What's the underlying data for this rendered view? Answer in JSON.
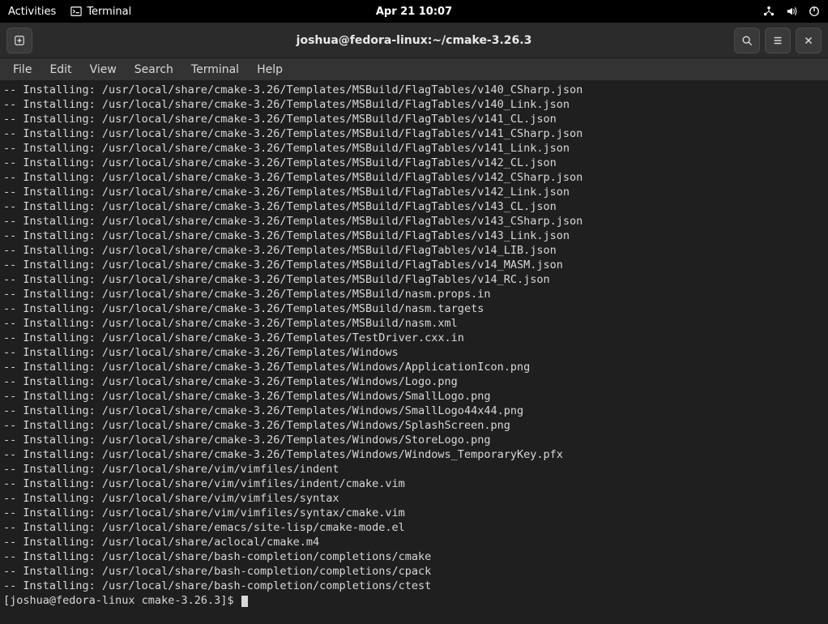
{
  "topbar": {
    "activities": "Activities",
    "app_name": "Terminal",
    "datetime": "Apr 21  10:07"
  },
  "titlebar": {
    "title": "joshua@fedora-linux:~/cmake-3.26.3"
  },
  "menubar": {
    "file": "File",
    "edit": "Edit",
    "view": "View",
    "search": "Search",
    "terminal": "Terminal",
    "help": "Help"
  },
  "terminal": {
    "lines": [
      "-- Installing: /usr/local/share/cmake-3.26/Templates/MSBuild/FlagTables/v140_CSharp.json",
      "-- Installing: /usr/local/share/cmake-3.26/Templates/MSBuild/FlagTables/v140_Link.json",
      "-- Installing: /usr/local/share/cmake-3.26/Templates/MSBuild/FlagTables/v141_CL.json",
      "-- Installing: /usr/local/share/cmake-3.26/Templates/MSBuild/FlagTables/v141_CSharp.json",
      "-- Installing: /usr/local/share/cmake-3.26/Templates/MSBuild/FlagTables/v141_Link.json",
      "-- Installing: /usr/local/share/cmake-3.26/Templates/MSBuild/FlagTables/v142_CL.json",
      "-- Installing: /usr/local/share/cmake-3.26/Templates/MSBuild/FlagTables/v142_CSharp.json",
      "-- Installing: /usr/local/share/cmake-3.26/Templates/MSBuild/FlagTables/v142_Link.json",
      "-- Installing: /usr/local/share/cmake-3.26/Templates/MSBuild/FlagTables/v143_CL.json",
      "-- Installing: /usr/local/share/cmake-3.26/Templates/MSBuild/FlagTables/v143_CSharp.json",
      "-- Installing: /usr/local/share/cmake-3.26/Templates/MSBuild/FlagTables/v143_Link.json",
      "-- Installing: /usr/local/share/cmake-3.26/Templates/MSBuild/FlagTables/v14_LIB.json",
      "-- Installing: /usr/local/share/cmake-3.26/Templates/MSBuild/FlagTables/v14_MASM.json",
      "-- Installing: /usr/local/share/cmake-3.26/Templates/MSBuild/FlagTables/v14_RC.json",
      "-- Installing: /usr/local/share/cmake-3.26/Templates/MSBuild/nasm.props.in",
      "-- Installing: /usr/local/share/cmake-3.26/Templates/MSBuild/nasm.targets",
      "-- Installing: /usr/local/share/cmake-3.26/Templates/MSBuild/nasm.xml",
      "-- Installing: /usr/local/share/cmake-3.26/Templates/TestDriver.cxx.in",
      "-- Installing: /usr/local/share/cmake-3.26/Templates/Windows",
      "-- Installing: /usr/local/share/cmake-3.26/Templates/Windows/ApplicationIcon.png",
      "-- Installing: /usr/local/share/cmake-3.26/Templates/Windows/Logo.png",
      "-- Installing: /usr/local/share/cmake-3.26/Templates/Windows/SmallLogo.png",
      "-- Installing: /usr/local/share/cmake-3.26/Templates/Windows/SmallLogo44x44.png",
      "-- Installing: /usr/local/share/cmake-3.26/Templates/Windows/SplashScreen.png",
      "-- Installing: /usr/local/share/cmake-3.26/Templates/Windows/StoreLogo.png",
      "-- Installing: /usr/local/share/cmake-3.26/Templates/Windows/Windows_TemporaryKey.pfx",
      "-- Installing: /usr/local/share/vim/vimfiles/indent",
      "-- Installing: /usr/local/share/vim/vimfiles/indent/cmake.vim",
      "-- Installing: /usr/local/share/vim/vimfiles/syntax",
      "-- Installing: /usr/local/share/vim/vimfiles/syntax/cmake.vim",
      "-- Installing: /usr/local/share/emacs/site-lisp/cmake-mode.el",
      "-- Installing: /usr/local/share/aclocal/cmake.m4",
      "-- Installing: /usr/local/share/bash-completion/completions/cmake",
      "-- Installing: /usr/local/share/bash-completion/completions/cpack",
      "-- Installing: /usr/local/share/bash-completion/completions/ctest"
    ],
    "prompt": "[joshua@fedora-linux cmake-3.26.3]$ "
  }
}
